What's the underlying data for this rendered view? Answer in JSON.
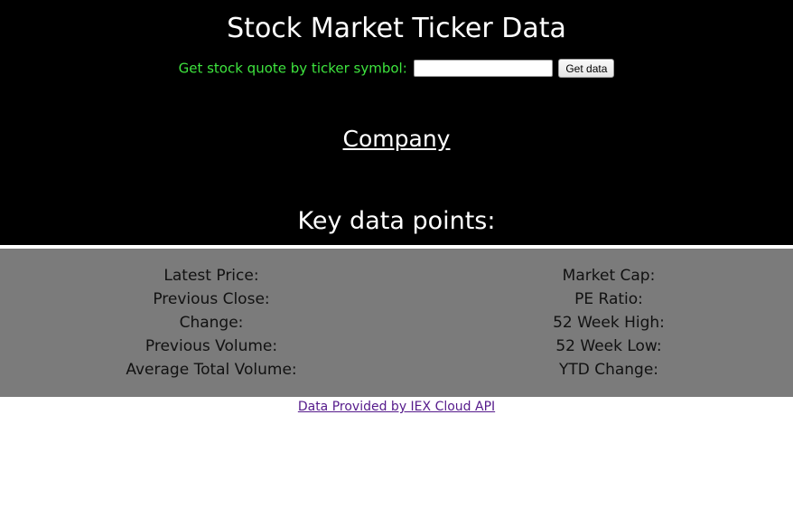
{
  "header": {
    "title": "Stock Market Ticker Data",
    "quote_label": "Get stock quote by ticker symbol:",
    "ticker_value": "",
    "button_label": "Get data"
  },
  "company": {
    "name": "Company"
  },
  "key_data": {
    "heading": "Key data points:",
    "left": [
      "Latest Price:",
      "Previous Close:",
      "Change:",
      "Previous Volume:",
      "Average Total Volume:"
    ],
    "right": [
      "Market Cap:",
      "PE Ratio:",
      "52 Week High:",
      "52 Week Low:",
      "YTD Change:"
    ]
  },
  "footer": {
    "credit_link": "Data Provided by IEX Cloud API"
  },
  "colors": {
    "header_bg": "#000000",
    "label_green": "#3ee43e",
    "panel_gray": "#7b7b7b",
    "link_visited": "#551a8b"
  }
}
